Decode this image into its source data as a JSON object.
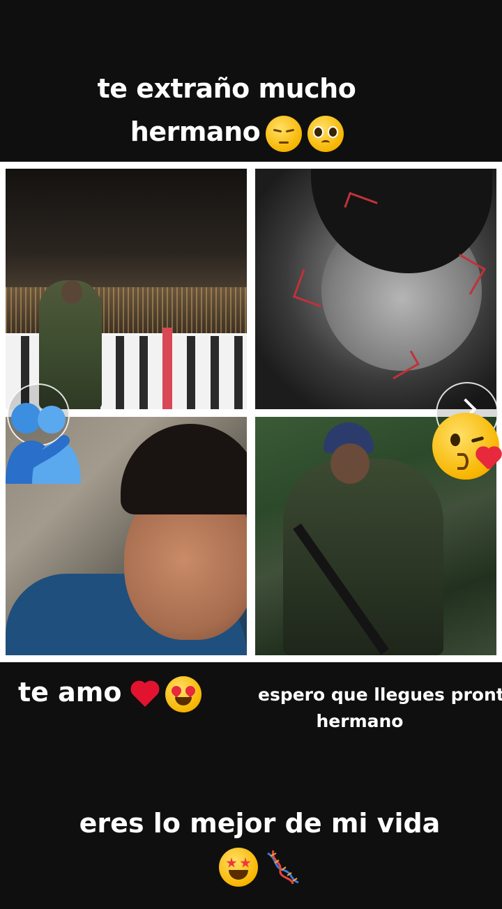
{
  "captions": {
    "top_line1": "te extraño mucho",
    "top_line2": "hermano",
    "te_amo": "te amo",
    "espero_line1": "espero que llegues pronto",
    "espero_line2": "hermano",
    "bottom": "eres lo mejor de mi vida"
  },
  "icons": {
    "top_emojis": [
      "pensive-face",
      "pleading-face"
    ],
    "te_amo_emojis": [
      "red-heart",
      "heart-eyes-face"
    ],
    "bottom_emojis": [
      "star-struck-face",
      "dna"
    ],
    "overlay_left": "hug-people",
    "overlay_right": "kissing-face-with-heart"
  },
  "colors": {
    "background": "#0f0f0f",
    "text": "#ffffff",
    "collage_border": "#ffffff"
  }
}
